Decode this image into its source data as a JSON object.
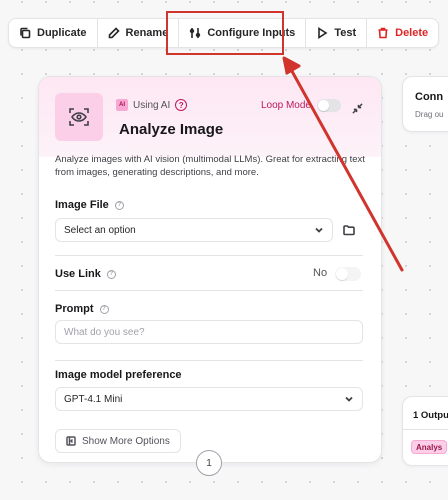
{
  "toolbar": {
    "duplicate": "Duplicate",
    "rename": "Rename",
    "configure_inputs": "Configure Inputs",
    "test": "Test",
    "delete": "Delete"
  },
  "node": {
    "ai_tag": "Using AI",
    "ai_badge": "AI",
    "title": "Analyze Image",
    "loop_mode": "Loop Mode",
    "description": "Analyze images with AI vision (multimodal LLMs). Great for extracting text from images, generating descriptions, and more.",
    "image_file_label": "Image File",
    "image_file_value": "Select an option",
    "use_link_label": "Use Link",
    "use_link_value": "No",
    "prompt_label": "Prompt",
    "prompt_placeholder": "What do you see?",
    "model_label": "Image model preference",
    "model_value": "GPT-4.1 Mini",
    "show_more": "Show More Options",
    "handle_number": "1"
  },
  "side_nodes": {
    "top_title": "Conn",
    "top_sub": "Drag ou",
    "bottom_title": "1 Outpu",
    "bottom_chip": "Analys"
  },
  "colors": {
    "highlight": "#d0342c",
    "accent_pink": "#be185d",
    "danger": "#dc2626"
  }
}
